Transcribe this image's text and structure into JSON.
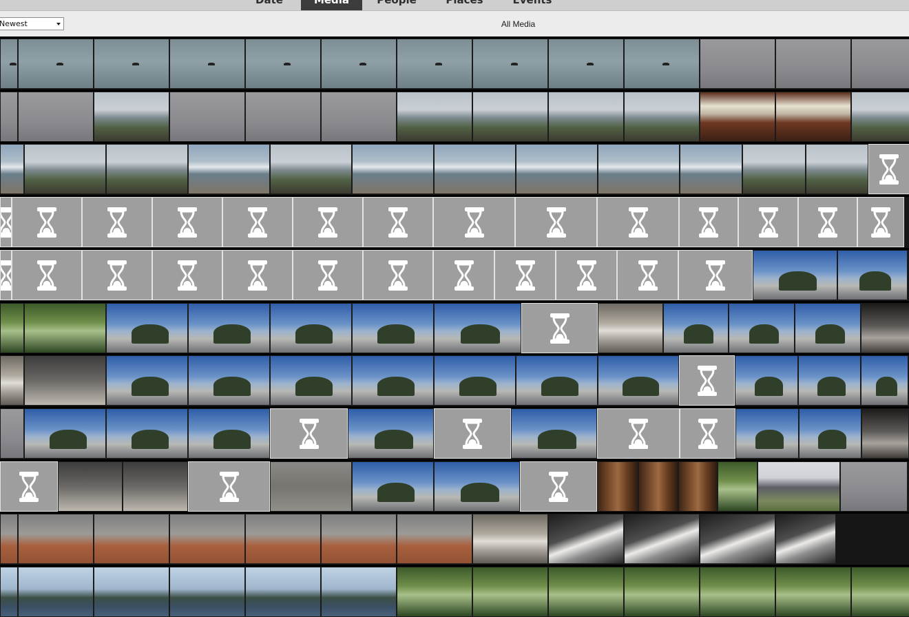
{
  "tabs": [
    {
      "label": "Date",
      "active": false
    },
    {
      "label": "Media",
      "active": true
    },
    {
      "label": "People",
      "active": false
    },
    {
      "label": "Places",
      "active": false
    },
    {
      "label": "Events",
      "active": false
    }
  ],
  "toolbar": {
    "sort_label": "Newest",
    "view_title": "All Media"
  },
  "grid": {
    "pending_icon": "hourglass-icon",
    "scenes": {
      "l": "lake water with birds",
      "g": "gray misty water",
      "c": "coast overlook",
      "d": "indoor dining window",
      "b": "beach with surf",
      "t": "sea stacks under blue sky",
      "r": "close-up rock",
      "h": "gray gravel",
      "p": "cedar trunk bark",
      "u": "lodge building",
      "s": "swallows on railing",
      "k": "wooden deck in sun",
      "m": "forest and hills",
      "w": "green woods",
      "n": "driftwood on sand",
      "x": "dark rock arch"
    },
    "colors": {
      "pending_fill": "#9e9e9e",
      "pending_icon": "#ffffff",
      "band": "#000000",
      "tab_active": "#3c3c3c"
    },
    "rows": [
      "l:26 l:110 l:110 l:110 l:110 l:110 l:110 l:110 l:110 l:110 g:110 g:110 g:88",
      "g:26 g:110 c:110 g:110 g:110 g:110 c:110 c:110 c:110 c:110 d:110 d:110 c:88",
      "b:35 c:119 c:119 b:119 c:119 b:119 b:119 b:119 b:119 b:91 c:92 c:91 *:60",
      "*:17 *:102 *:102 *:102 *:102 *:102 *:102 *:119 *:119 *:119 *:86 *:87 *:86 *:68",
      "*:17 *:102 *:102 *:102 *:102 *:102 *:102 *:89 *:89 *:89 *:89 *:108 t:123 t:102",
      "w:35 w:119 t:119 t:119 t:119 t:119 t:127 *:111 n:95 t:95 t:96 t:96 x:71",
      "n:35 r:119 t:119 t:119 t:119 t:119 t:119 t:119 t:118 *:81 t:92 t:91 t:69",
      "g:35 t:119 t:119 t:119 *:113 t:125 *:112 t:125 *:120 *:81 t:92 t:91 x:69",
      "*:84 r:94 r:95 *:119 h:119 t:119 t:125 *:112 p:60 p:58 p:57 w:58 u:120 g:98",
      "s:26 s:110 s:110 s:110 s:110 s:110 s:110 n:110 k:110 k:110 k:110 k:88",
      "m:26 m:110 m:110 m:110 m:110 m:110 w:110 w:110 w:110 w:110 w:110 w:110 w:88"
    ]
  }
}
